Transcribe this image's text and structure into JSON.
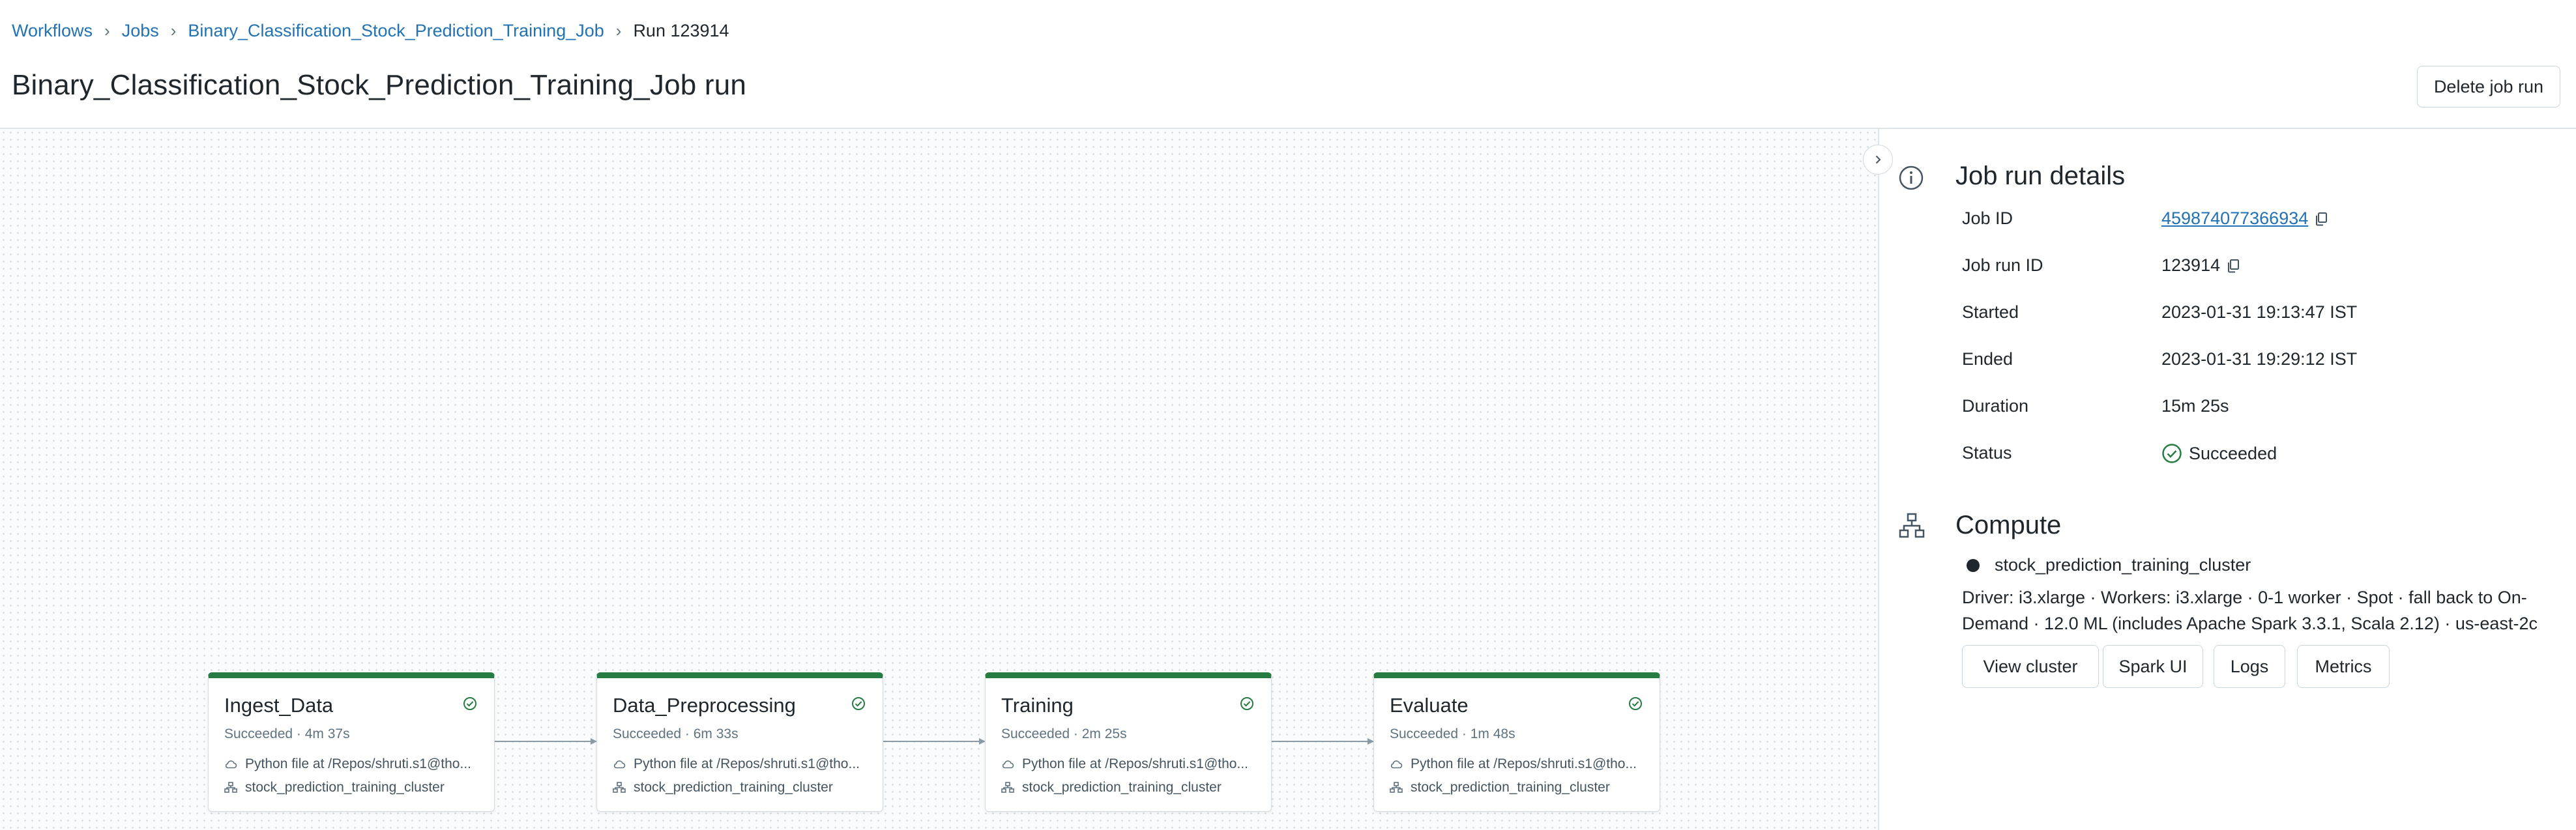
{
  "breadcrumb": {
    "workflows": "Workflows",
    "jobs": "Jobs",
    "job": "Binary_Classification_Stock_Prediction_Training_Job",
    "run": "Run 123914"
  },
  "page_title": "Binary_Classification_Stock_Prediction_Training_Job run",
  "actions": {
    "delete_label": "Delete job run"
  },
  "tasks": [
    {
      "name": "Ingest_Data",
      "status": "Succeeded · 4m 37s",
      "source": "Python file at /Repos/shruti.s1@tho...",
      "cluster": "stock_prediction_training_cluster"
    },
    {
      "name": "Data_Preprocessing",
      "status": "Succeeded · 6m 33s",
      "source": "Python file at /Repos/shruti.s1@tho...",
      "cluster": "stock_prediction_training_cluster"
    },
    {
      "name": "Training",
      "status": "Succeeded · 2m 25s",
      "source": "Python file at /Repos/shruti.s1@tho...",
      "cluster": "stock_prediction_training_cluster"
    },
    {
      "name": "Evaluate",
      "status": "Succeeded · 1m 48s",
      "source": "Python file at /Repos/shruti.s1@tho...",
      "cluster": "stock_prediction_training_cluster"
    }
  ],
  "details": {
    "title": "Job run details",
    "job_id_label": "Job ID",
    "job_id": "459874077366934",
    "run_id_label": "Job run ID",
    "run_id": "123914",
    "started_label": "Started",
    "started": "2023-01-31 19:13:47 IST",
    "ended_label": "Ended",
    "ended": "2023-01-31 19:29:12 IST",
    "duration_label": "Duration",
    "duration": "15m 25s",
    "status_label": "Status",
    "status": "Succeeded"
  },
  "compute": {
    "title": "Compute",
    "cluster_name": "stock_prediction_training_cluster",
    "description": "Driver: i3.xlarge · Workers: i3.xlarge · 0-1 worker · Spot · fall back to On-Demand · 12.0 ML (includes Apache Spark 3.3.1, Scala 2.12) · us-east-2c",
    "buttons": {
      "view_cluster": "View cluster",
      "spark_ui": "Spark UI",
      "logs": "Logs",
      "metrics": "Metrics"
    }
  },
  "colors": {
    "link": "#2272b4",
    "success": "#277c43",
    "border": "#cbd5dc",
    "text": "#1f272d"
  },
  "icons": {
    "info": "info-icon",
    "compute": "compute-icon",
    "copy": "copy-icon",
    "success": "check-circle-icon",
    "expand": "chevron-right-icon",
    "cloud": "cloud-icon",
    "cluster": "cluster-icon"
  }
}
